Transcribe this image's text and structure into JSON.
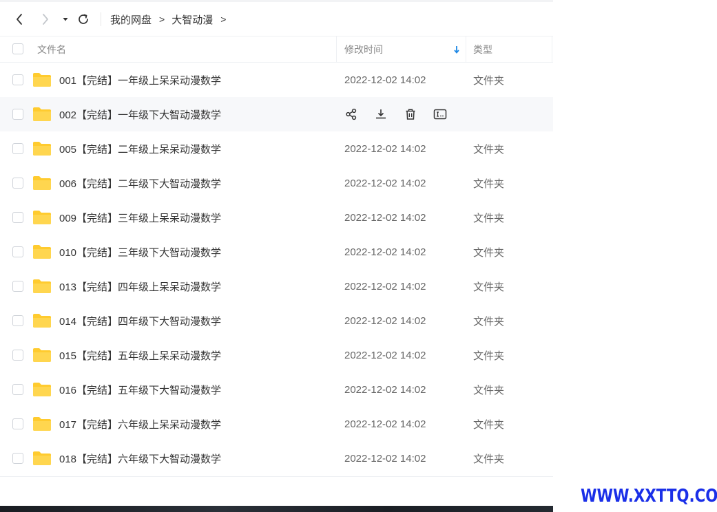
{
  "breadcrumb": [
    {
      "label": "我的网盘"
    },
    {
      "label": "大智动漫"
    }
  ],
  "breadcrumb_separator": ">",
  "header": {
    "name": "文件名",
    "modified": "修改时间",
    "type": "类型",
    "sort_icon": "arrow-down-icon"
  },
  "icons": {
    "back": "chevron-left-icon",
    "forward": "chevron-right-icon",
    "history": "caret-down-icon",
    "refresh": "refresh-icon",
    "folder": "folder-icon",
    "share": "share-icon",
    "download": "download-icon",
    "delete": "trash-icon",
    "rename": "rename-icon"
  },
  "colors": {
    "folder": "#ffcb2f",
    "sort_arrow": "#1e88e5",
    "hover_row": "#f7f8fa",
    "watermark": "#1a2fe8"
  },
  "files": [
    {
      "name": "001【完结】一年级上呆呆动漫数学",
      "modified": "2022-12-02 14:02",
      "type": "文件夹"
    },
    {
      "name": "002【完结】一年级下大智动漫数学",
      "modified": "",
      "type": "",
      "hovered": true
    },
    {
      "name": "005【完结】二年级上呆呆动漫数学",
      "modified": "2022-12-02 14:02",
      "type": "文件夹"
    },
    {
      "name": "006【完结】二年级下大智动漫数学",
      "modified": "2022-12-02 14:02",
      "type": "文件夹"
    },
    {
      "name": "009【完结】三年级上呆呆动漫数学",
      "modified": "2022-12-02 14:02",
      "type": "文件夹"
    },
    {
      "name": "010【完结】三年级下大智动漫数学",
      "modified": "2022-12-02 14:02",
      "type": "文件夹"
    },
    {
      "name": "013【完结】四年级上呆呆动漫数学",
      "modified": "2022-12-02 14:02",
      "type": "文件夹"
    },
    {
      "name": "014【完结】四年级下大智动漫数学",
      "modified": "2022-12-02 14:02",
      "type": "文件夹"
    },
    {
      "name": "015【完结】五年级上呆呆动漫数学",
      "modified": "2022-12-02 14:02",
      "type": "文件夹"
    },
    {
      "name": "016【完结】五年级下大智动漫数学",
      "modified": "2022-12-02 14:02",
      "type": "文件夹"
    },
    {
      "name": "017【完结】六年级上呆呆动漫数学",
      "modified": "2022-12-02 14:02",
      "type": "文件夹"
    },
    {
      "name": "018【完结】六年级下大智动漫数学",
      "modified": "2022-12-02 14:02",
      "type": "文件夹"
    }
  ],
  "watermark": "WWW.XXTTQ.COM"
}
